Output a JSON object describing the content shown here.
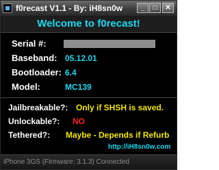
{
  "window": {
    "title": "f0recast V1.1 - By: iH8sn0w",
    "minimize_glyph": "_",
    "maximize_glyph": "□",
    "close_glyph": "✕"
  },
  "welcome": "Welcome to f0recast!",
  "device": {
    "serial_label": "Serial #:",
    "serial_value": "",
    "baseband_label": "Baseband:",
    "baseband_value": "05.12.01",
    "bootloader_label": "Bootloader:",
    "bootloader_value": "6.4",
    "model_label": "Model:",
    "model_value": "MC139"
  },
  "status": {
    "jailbreakable_label": "Jailbreakable?:",
    "jailbreakable_value": "Only if SHSH is saved.",
    "unlockable_label": "Unlockable?:",
    "unlockable_value": "NO",
    "tethered_label": "Tethered?:",
    "tethered_value": "Maybe - Depends if Refurb"
  },
  "link": "http://iH8sn0w.com",
  "statusbar": "iPhone 3GS (Firmware: 3.1.3) Connected",
  "colors": {
    "accent_cyan": "#1fd7f0",
    "warning_yellow": "#f2e600",
    "error_red": "#ff2222",
    "background": "#000000"
  },
  "icons": {
    "app": "app-icon",
    "minimize": "minimize-icon",
    "maximize": "maximize-icon",
    "close": "close-icon"
  }
}
